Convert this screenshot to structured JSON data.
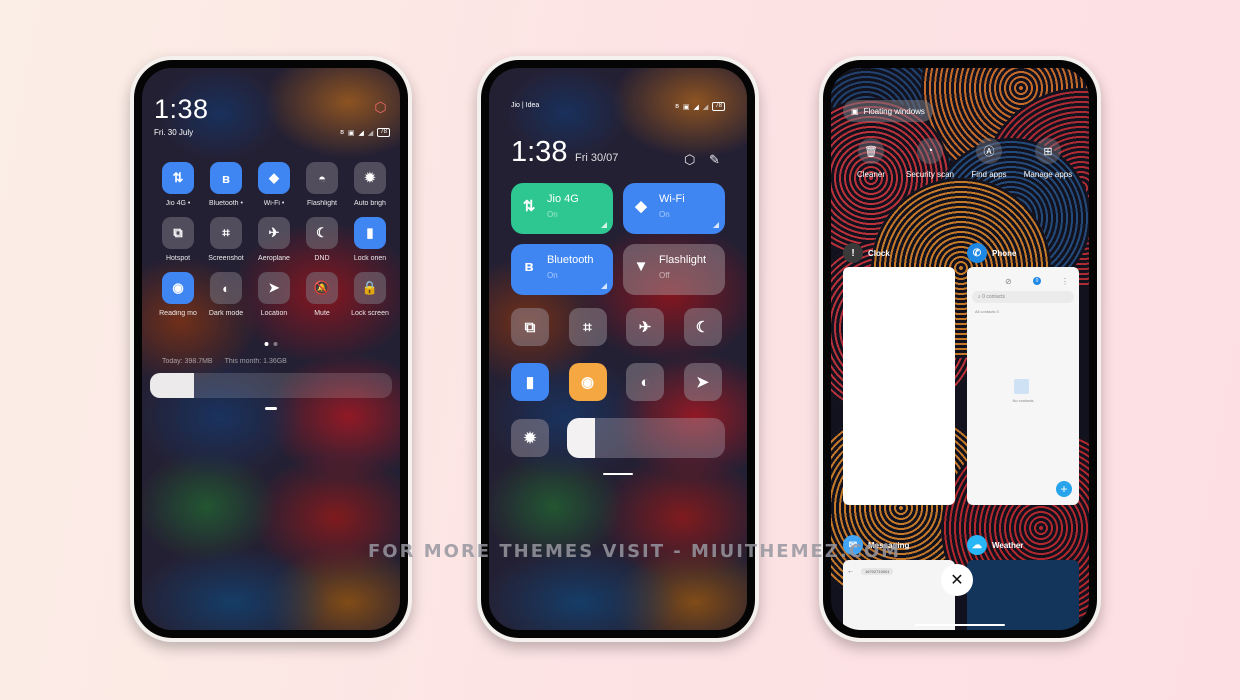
{
  "phone1": {
    "time": "1:38",
    "date": "Fri. 30 July",
    "battery": "78",
    "tiles": [
      {
        "label": "Jio 4G •",
        "icon": "⇅",
        "name": "mobile-data",
        "on": true
      },
      {
        "label": "Bluetooth •",
        "icon": "ʙ",
        "name": "bluetooth",
        "on": true
      },
      {
        "label": "Wi-Fi •",
        "icon": "◆",
        "name": "wifi",
        "on": true
      },
      {
        "label": "Flashlight",
        "icon": "◓",
        "name": "flashlight",
        "on": false
      },
      {
        "label": "Auto brigh",
        "icon": "✹",
        "name": "auto-brightness",
        "on": false
      },
      {
        "label": "Hotspot",
        "icon": "⧉",
        "name": "hotspot",
        "on": false
      },
      {
        "label": "Screenshot",
        "icon": "⌗",
        "name": "screenshot",
        "on": false
      },
      {
        "label": "Aeroplane",
        "icon": "✈",
        "name": "aeroplane",
        "on": false
      },
      {
        "label": "DND",
        "icon": "☾",
        "name": "dnd",
        "on": false
      },
      {
        "label": "Lock orien",
        "icon": "▮",
        "name": "lock-orientation",
        "on": true
      },
      {
        "label": "Reading mo",
        "icon": "◉",
        "name": "reading-mode",
        "on": true
      },
      {
        "label": "Dark mode",
        "icon": "◐",
        "name": "dark-mode",
        "on": false
      },
      {
        "label": "Location",
        "icon": "➤",
        "name": "location",
        "on": false
      },
      {
        "label": "Mute",
        "icon": "🔕",
        "name": "mute",
        "on": false
      },
      {
        "label": "Lock screen",
        "icon": "🔒",
        "name": "lock-screen",
        "on": false
      }
    ],
    "usage_today": "Today: 398.7MB",
    "usage_month": "This month: 1.36GB",
    "brightness_fraction": 0.18,
    "page_count": 2,
    "active_page": 1
  },
  "phone2": {
    "carrier": "Jio | Idea",
    "battery": "78",
    "time": "1:38",
    "date": "Fri 30/07",
    "big_tiles": [
      {
        "title": "Jio 4G",
        "state": "On",
        "icon": "⇅",
        "color": "#2ec791"
      },
      {
        "title": "Wi-Fi",
        "state": "On",
        "icon": "◆",
        "color": "#3f86f3"
      },
      {
        "title": "Bluetooth",
        "state": "On",
        "icon": "ʙ",
        "color": "#3f86f3"
      },
      {
        "title": "Flashlight",
        "state": "Off",
        "icon": "▼",
        "color": "rgba(170,160,165,.45)"
      }
    ],
    "small_tiles": [
      {
        "name": "hotspot",
        "icon": "⧉"
      },
      {
        "name": "screenshot",
        "icon": "⌗"
      },
      {
        "name": "aeroplane",
        "icon": "✈"
      },
      {
        "name": "dnd",
        "icon": "☾"
      },
      {
        "name": "lock-orientation",
        "icon": "▮",
        "color": "#3f86f3"
      },
      {
        "name": "reading-mode",
        "icon": "◉",
        "color": "#f5a742"
      },
      {
        "name": "dark-mode",
        "icon": "◐"
      },
      {
        "name": "location",
        "icon": "➤"
      }
    ],
    "auto_brightness_icon": "✹",
    "brightness_fraction": 0.18
  },
  "phone3": {
    "floating_windows": "Floating windows",
    "quick_actions": [
      {
        "label": "Cleaner",
        "icon": "🗑"
      },
      {
        "label": "Security scan",
        "icon": "◔"
      },
      {
        "label": "Find apps",
        "icon": "Ⓐ"
      },
      {
        "label": "Manage apps",
        "icon": "⊞"
      }
    ],
    "apps": [
      {
        "name": "Clock",
        "icon": "!",
        "color": "#3a3a3a"
      },
      {
        "name": "Phone",
        "icon": "✆",
        "color": "#1e88e5"
      },
      {
        "name": "Messaging",
        "icon": "✉",
        "color": "#42a5f5"
      },
      {
        "name": "Weather",
        "icon": "☁",
        "color": "#29b6f6"
      }
    ],
    "phone_card": {
      "search_placeholder": "0 contacts",
      "all_contacts": "All contacts  0",
      "empty": "No contacts",
      "badge": "0"
    },
    "messaging_card": {
      "number": "16702710001"
    },
    "close_icon": "✕"
  },
  "watermark": "FOR MORE THEMES VISIT - MIUITHEMEZ.COM"
}
